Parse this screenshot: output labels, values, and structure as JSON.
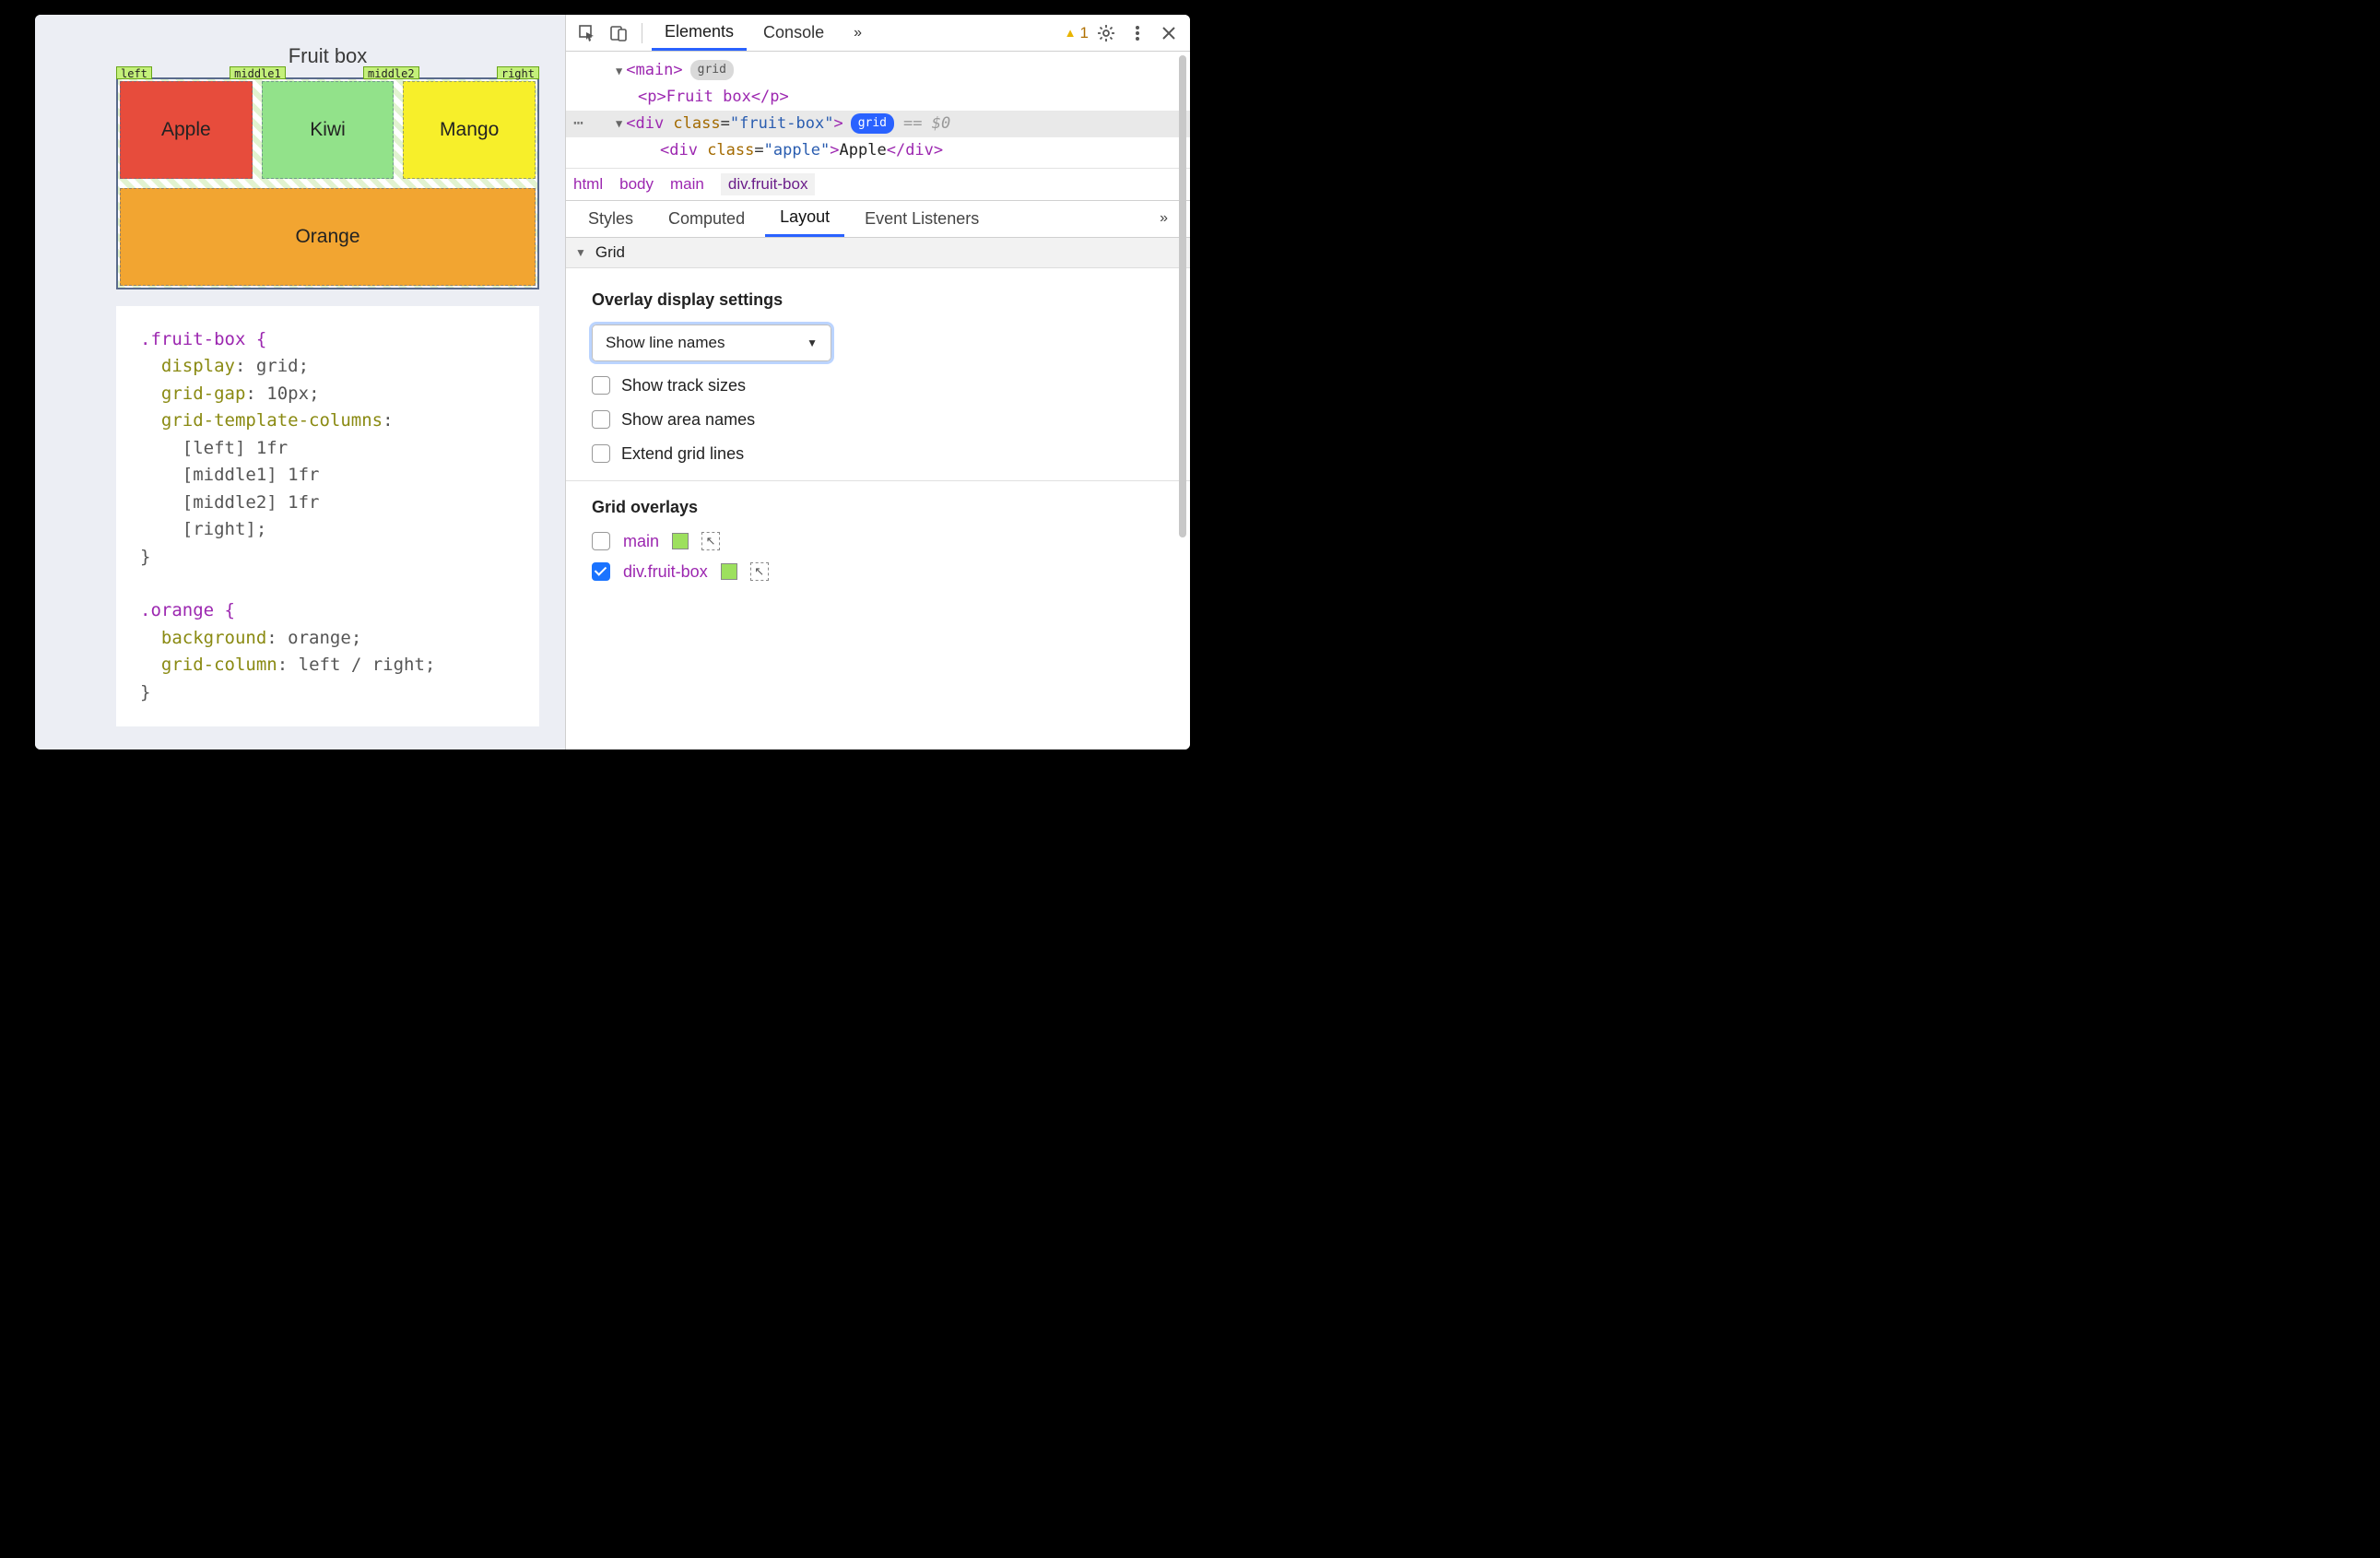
{
  "viewport": {
    "title": "Fruit box",
    "lineNames": [
      "left",
      "middle1",
      "middle2",
      "right"
    ],
    "cells": {
      "apple": "Apple",
      "kiwi": "Kiwi",
      "mango": "Mango",
      "orange": "Orange"
    },
    "css": {
      "rule1_selector": ".fruit-box {",
      "rule1_p1": "display",
      "rule1_v1": "grid",
      "rule1_p2": "grid-gap",
      "rule1_v2": "10px",
      "rule1_p3": "grid-template-columns",
      "rule1_l1": "[left] 1fr",
      "rule1_l2": "[middle1] 1fr",
      "rule1_l3": "[middle2] 1fr",
      "rule1_l4": "[right]",
      "rule2_selector": ".orange {",
      "rule2_p1": "background",
      "rule2_v1": "orange",
      "rule2_p2": "grid-column",
      "rule2_v2": "left / right"
    }
  },
  "devtools": {
    "tabs": {
      "elements": "Elements",
      "console": "Console",
      "more": "»"
    },
    "warningCount": "1",
    "dom": {
      "main_open": "<main>",
      "main_badge": "grid",
      "p_line": "<p>Fruit box</p>",
      "div_open_pre": "<div ",
      "div_open_class": "class",
      "div_open_val": "\"fruit-box\"",
      "div_open_post": ">",
      "div_badge": "grid",
      "eq0": "== $0",
      "child_pre": "<div ",
      "child_class": "class",
      "child_val": "\"apple\"",
      "child_text": "Apple",
      "child_close": "</div>"
    },
    "breadcrumb": [
      "html",
      "body",
      "main",
      "div.fruit-box"
    ],
    "paneTabs": {
      "styles": "Styles",
      "computed": "Computed",
      "layout": "Layout",
      "events": "Event Listeners",
      "more": "»"
    },
    "layout": {
      "sectionTitle": "Grid",
      "overlayHeading": "Overlay display settings",
      "selectValue": "Show line names",
      "opt_trackSizes": "Show track sizes",
      "opt_areaNames": "Show area names",
      "opt_extend": "Extend grid lines",
      "gridOverlaysHeading": "Grid overlays",
      "overlays": [
        {
          "name": "main",
          "checked": false
        },
        {
          "name": "div.fruit-box",
          "checked": true
        }
      ]
    }
  }
}
